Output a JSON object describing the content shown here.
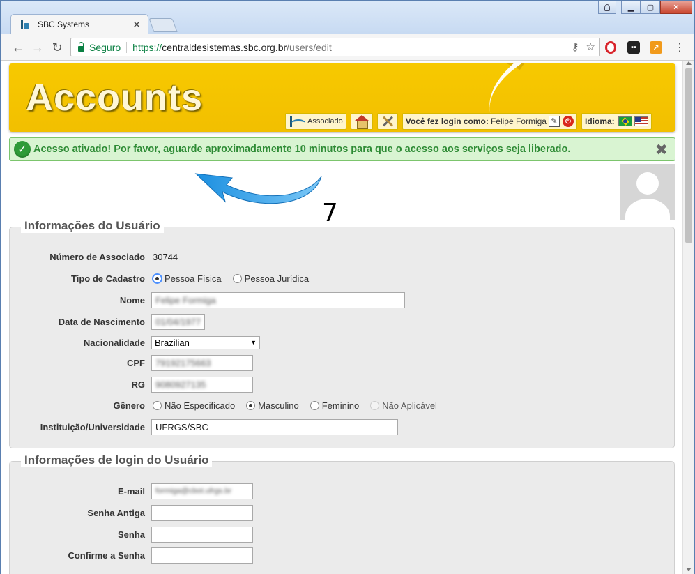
{
  "browser": {
    "tab_title": "SBC Systems",
    "tab_close": "✕",
    "secure_label": "Seguro",
    "url_scheme": "https://",
    "url_host": "centraldesistemas.sbc.org.br",
    "url_path": "/users/edit"
  },
  "banner": {
    "title": "Accounts",
    "associado_label": "Associado",
    "login_prefix": "Você fez login como:",
    "user_name": "Felipe Formiga",
    "idioma_label": "Idioma:"
  },
  "message": {
    "text": "Acesso ativado! Por favor, aguarde aproximadamente 10 minutos para que o acesso aos serviços seja liberado.",
    "close": "✖"
  },
  "annotation": {
    "number": "7"
  },
  "user_info": {
    "legend": "Informações do Usuário",
    "member_number_label": "Número de Associado",
    "member_number_value": "30744",
    "registration_type_label": "Tipo de Cadastro",
    "registration_options": [
      "Pessoa Física",
      "Pessoa Jurídica"
    ],
    "name_label": "Nome",
    "name_value": "Felipe Formiga",
    "birth_label": "Data de Nascimento",
    "birth_value": "01/04/1977",
    "nationality_label": "Nacionalidade",
    "nationality_value": "Brazilian",
    "cpf_label": "CPF",
    "cpf_value": "79192175663",
    "rg_label": "RG",
    "rg_value": "9080927135",
    "gender_label": "Gênero",
    "gender_options": [
      "Não Especificado",
      "Masculino",
      "Feminino",
      "Não Aplicável"
    ],
    "institution_label": "Instituição/Universidade",
    "institution_value": "UFRGS/SBC"
  },
  "login_info": {
    "legend": "Informações de login do Usuário",
    "email_label": "E-mail",
    "email_value": "formiga@cbot.ufrgs.br",
    "old_password_label": "Senha Antiga",
    "password_label": "Senha",
    "confirm_password_label": "Confirme a Senha"
  },
  "colors": {
    "banner_yellow": "#f7c900",
    "success_green": "#2e8b35",
    "success_bg": "#d9f4d2",
    "secure_green": "#0b8043"
  }
}
